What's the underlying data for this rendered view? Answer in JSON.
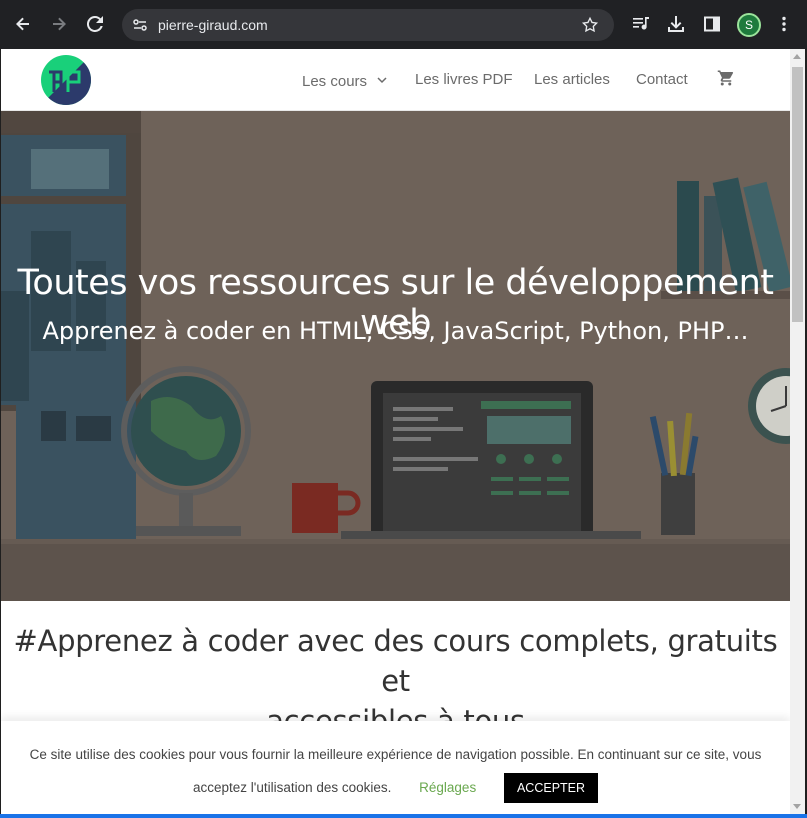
{
  "browser": {
    "url": "pierre-giraud.com",
    "profile_initial": "S",
    "icons": [
      "back-icon",
      "forward-icon",
      "reload-icon",
      "site-info-icon",
      "star-icon",
      "media-icon",
      "download-icon",
      "side-panel-icon",
      "more-icon"
    ]
  },
  "site": {
    "nav": {
      "courses_label": "Les cours",
      "books_label": "Les livres PDF",
      "articles_label": "Les articles",
      "contact_label": "Contact"
    },
    "hero": {
      "title": "Toutes vos ressources sur le développement web",
      "subtitle": "Apprenez à coder en HTML, CSS, JavaScript, Python, PHP…"
    },
    "heading_line1": "#Apprenez à coder avec des cours complets, gratuits et",
    "heading_line2": "accessibles à tous",
    "cookie": {
      "text_part1": "Ce site utilise des cookies pour vous fournir la meilleure expérience de navigation possible. En continuant sur ce site, vous",
      "text_part2": "acceptez l'utilisation des cookies.",
      "settings_label": "Réglages",
      "accept_label": "ACCEPTER"
    }
  },
  "colors": {
    "logo_green": "#19d07a",
    "logo_navy": "#2c3a6b",
    "accent_green": "#6aa84f"
  }
}
